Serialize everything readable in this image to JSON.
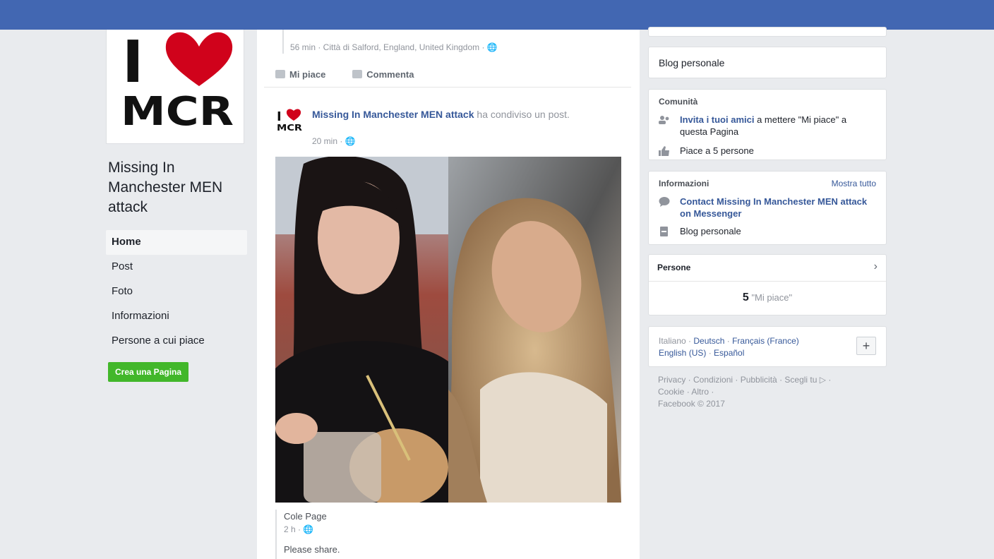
{
  "left": {
    "logo": {
      "i": "I",
      "mcr": "MCR"
    },
    "page_name": "Missing In Manchester MEN attack",
    "nav": [
      {
        "label": "Home",
        "active": true
      },
      {
        "label": "Post"
      },
      {
        "label": "Foto"
      },
      {
        "label": "Informazioni"
      },
      {
        "label": "Persone a cui piace"
      }
    ],
    "create_page": "Crea una Pagina"
  },
  "feed": {
    "prev_post": {
      "meta": "56 min · Città di Salford, England, United Kingdom · 🌐"
    },
    "actions": {
      "like": "Mi piace",
      "comment": "Commenta"
    },
    "post": {
      "author": "Missing In Manchester MEN attack",
      "verb": " ha condiviso un post.",
      "time": "20 min · 🌐",
      "shared_name": "Cole Page",
      "shared_time": "2 h · 🌐",
      "shared_text": "Please share."
    }
  },
  "right": {
    "blog": "Blog personale",
    "community": {
      "title": "Comunità",
      "invite_link": "Invita i tuoi amici",
      "invite_rest": " a mettere \"Mi piace\" a questa Pagina",
      "likes": "Piace a 5 persone"
    },
    "info": {
      "title": "Informazioni",
      "see_all": "Mostra tutto",
      "contact": "Contact Missing In Manchester MEN attack on Messenger",
      "blog": "Blog personale"
    },
    "people": {
      "title": "Persone",
      "count": "5",
      "count_label": "\"Mi piace\""
    },
    "languages": {
      "current": "Italiano",
      "sep": " · ",
      "others": [
        "Deutsch",
        "Français (France)",
        "English (US)",
        "Español"
      ]
    },
    "footer": {
      "line1": "Privacy · Condizioni · Pubblicità · Scegli tu ▷ ·",
      "line2": "Cookie · Altro ·",
      "line3": "Facebook © 2017"
    }
  },
  "colors": {
    "topbar": "#4267b2",
    "link": "#365899",
    "create_button": "#42b72a",
    "heart": "#d0021b"
  }
}
